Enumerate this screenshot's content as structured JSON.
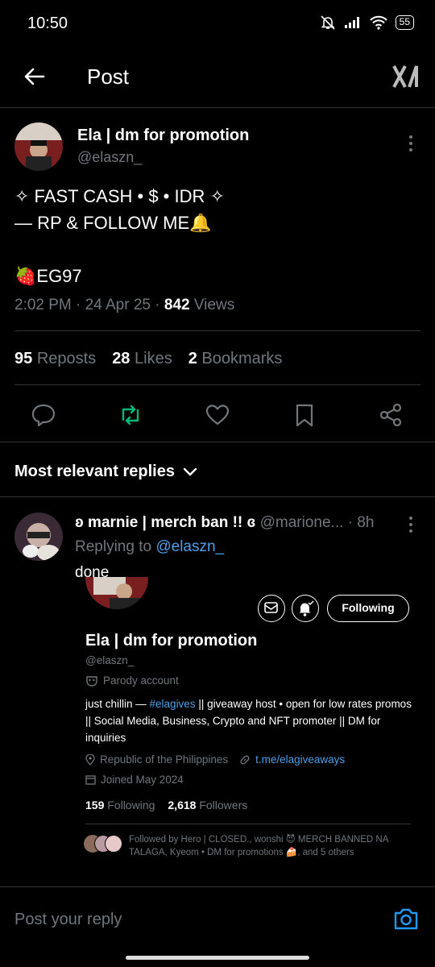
{
  "status": {
    "time": "10:50",
    "battery": "55"
  },
  "header": {
    "title": "Post"
  },
  "post": {
    "author_name": "Ela | dm for promotion",
    "author_handle": "@elaszn_",
    "line1": "✧ FAST CASH • $ • IDR ✧",
    "line2": "— RP & FOLLOW ME🔔",
    "line3": "🍓EG97",
    "meta_time": "2:02 PM · 24 Apr 25 · ",
    "views_count": "842",
    "views_label": " Views",
    "reposts_count": "95",
    "reposts_label": "Reposts",
    "likes_count": "28",
    "likes_label": "Likes",
    "bookmarks_count": "2",
    "bookmarks_label": "Bookmarks"
  },
  "replies_header": "Most relevant replies",
  "reply": {
    "name": "ʚ marnie | merch ban !! ɞ",
    "handle": "@marione...",
    "time": "· 8h",
    "replying_prefix": "Replying to ",
    "replying_handle": "@elaszn_",
    "text": "done"
  },
  "profile_card": {
    "name": "Ela | dm for promotion",
    "handle": "@elaszn_",
    "parody": "Parody account",
    "bio_1": "just chillin — ",
    "bio_hashtag": "#elagives",
    "bio_2": " || giveaway host • open for low rates promos || Social Media, Business, Crypto and NFT promoter || DM for inquiries",
    "location": "Republic of the Philippines",
    "website": "t.me/elagiveaways",
    "joined": "Joined May 2024",
    "following_count": "159",
    "following_label": "Following",
    "followers_count": "2,618",
    "followers_label": "Followers",
    "following_button": "Following",
    "followed_by": "Followed by Hero | CLOSED., wonshi 😈 MERCH BANNED NA TALAGA, Kyeom • DM for promotions 🍰, and 5 others"
  },
  "composer": {
    "placeholder": "Post your reply"
  },
  "colors": {
    "accent": "#1d9bf0",
    "repost_active": "#00ba7c",
    "muted": "#71767b"
  }
}
